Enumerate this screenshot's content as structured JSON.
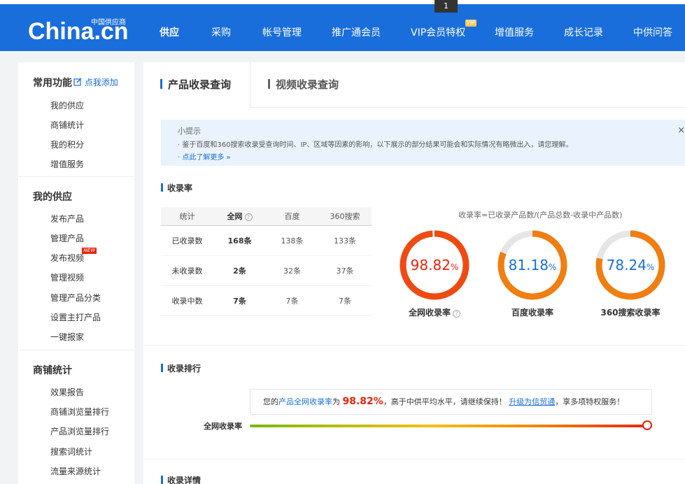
{
  "badge": "1",
  "logo": {
    "main": "China.cn",
    "sub": "中国供应商"
  },
  "nav": [
    {
      "label": "供应",
      "active": true
    },
    {
      "label": "采购"
    },
    {
      "label": "帐号管理"
    },
    {
      "label": "推广通会员"
    },
    {
      "label": "VIP会员特权",
      "tag": "VIP"
    },
    {
      "label": "增值服务"
    },
    {
      "label": "成长记录"
    },
    {
      "label": "中供问答"
    }
  ],
  "sidebar": {
    "common": {
      "title": "常用功能",
      "add": "点我添加",
      "items": [
        "我的供应",
        "商铺统计",
        "我的积分",
        "增值服务"
      ]
    },
    "supply": {
      "title": "我的供应",
      "items": [
        "发布产品",
        "管理产品",
        "发布视频",
        "管理视频",
        "管理产品分类",
        "设置主打产品",
        "一键报家"
      ],
      "new_tag": "NEW"
    },
    "stats": {
      "title": "商铺统计",
      "items": [
        "效果报告",
        "商铺浏览量排行",
        "产品浏览量排行",
        "搜索词统计",
        "流量来源统计"
      ]
    }
  },
  "tabs": [
    "产品收录查询",
    "视频收录查询"
  ],
  "tip": {
    "title": "小提示",
    "text": "· 鉴于百度和360搜索收录受查询时间、IP、区域等因素的影响，以下展示的部分结果可能会和实际情况有略微出入，请您理解。",
    "link": "· 点此了解更多 »",
    "close": "×"
  },
  "section_rate": "收录率",
  "table": {
    "headers": [
      "统计",
      "全网",
      "百度",
      "360搜索"
    ],
    "rows": [
      [
        "已收录数",
        "168条",
        "138条",
        "133条"
      ],
      [
        "未收录数",
        "2条",
        "32条",
        "37条"
      ],
      [
        "收录中数",
        "7条",
        "7条",
        "7条"
      ]
    ]
  },
  "formula": "收录率=已收录产品数/(产品总数-收录中产品数)",
  "gauges": [
    {
      "value": 98.82,
      "display": "98.82",
      "label": "全网收录率",
      "color": "#e8230c"
    },
    {
      "value": 81.18,
      "display": "81.18",
      "label": "百度收录率",
      "color": "#1a6edb"
    },
    {
      "value": 78.24,
      "display": "78.24",
      "label": "360搜索收录率",
      "color": "#1a6edb"
    }
  ],
  "pct_sign": "%",
  "help": "?",
  "section_rank": "收录排行",
  "rank": {
    "pre": "您的",
    "blue": "产品全网收录率",
    "mid": "为",
    "value": "98.82%",
    "text2": "，高于中供平均水平，请继续保持！",
    "link": "升级为信贸通",
    "text3": "，享多项特权服务！",
    "label": "全网收录率",
    "fraction": 0.9882
  },
  "section_detail": "收录详情"
}
